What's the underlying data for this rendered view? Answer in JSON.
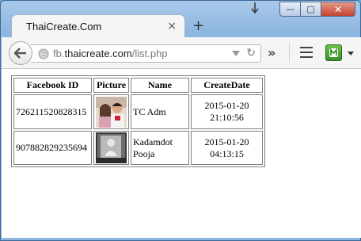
{
  "browser": {
    "tab_title": "ThaiCreate.Com",
    "tab_close": "×",
    "new_tab": "+",
    "url_prefix": "fb.",
    "url_domain": "thaicreate.com",
    "url_path": "/list.php",
    "overflow": "»"
  },
  "caption": {
    "minimize": "—",
    "maximize": "▢",
    "close": "✕"
  },
  "table": {
    "headers": [
      "Facebook ID",
      "Picture",
      "Name",
      "CreateDate"
    ],
    "rows": [
      {
        "facebook_id": "726211520828315",
        "picture": "profile-photo-couple",
        "name": "TC Adm",
        "date": "2015-01-20",
        "time": "21:10:56"
      },
      {
        "facebook_id": "907882829235694",
        "picture": "profile-photo-person",
        "name_line1": "Kadamdot",
        "name_line2": "Pooja",
        "date": "2015-01-20",
        "time": "04:13:15"
      }
    ]
  },
  "colors": {
    "titlebar": "#8db6e0",
    "ext_icon": "#4ea834",
    "close_button": "#c4432e"
  }
}
